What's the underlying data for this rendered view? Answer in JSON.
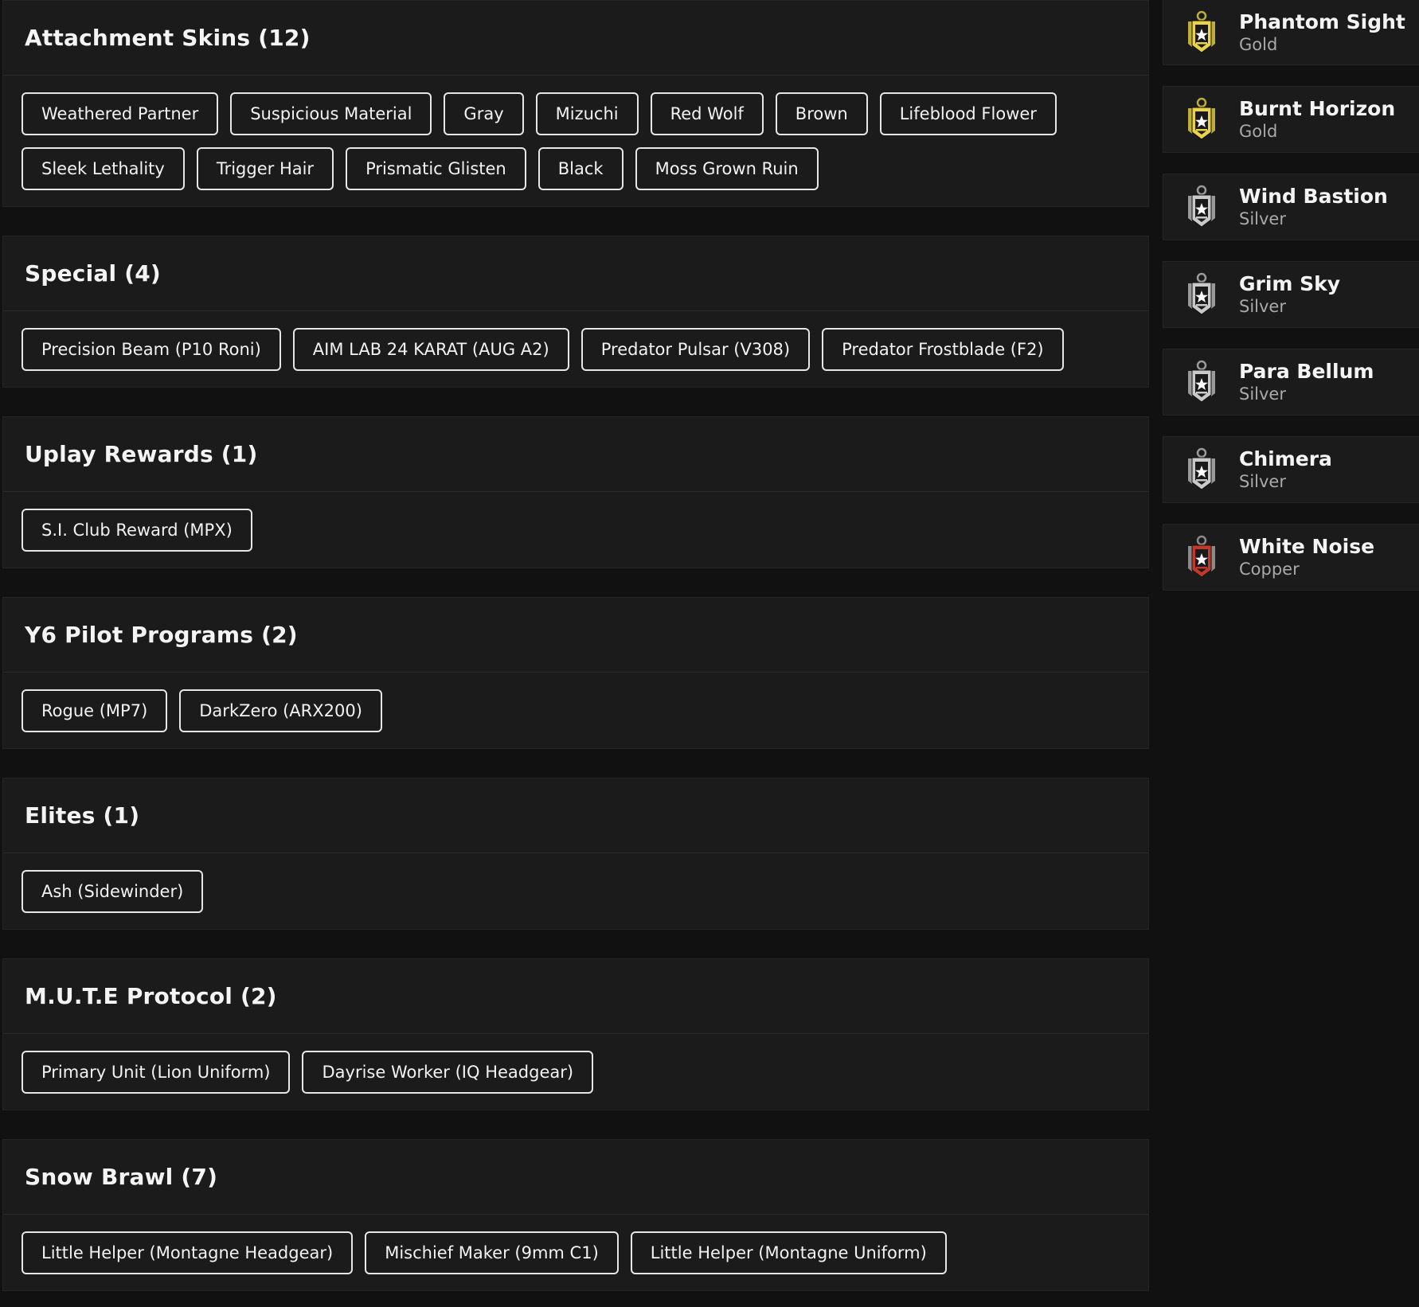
{
  "colors": {
    "gold": "#e8d34a",
    "silver": "#c9c9c9",
    "copper": "#c0392b",
    "background": "#111111",
    "panel": "#1b1b1c"
  },
  "sections": [
    {
      "title": "Attachment Skins (12)",
      "items": [
        "Weathered Partner",
        "Suspicious Material",
        "Gray",
        "Mizuchi",
        "Red Wolf",
        "Brown",
        "Lifeblood Flower",
        "Sleek Lethality",
        "Trigger Hair",
        "Prismatic Glisten",
        "Black",
        "Moss Grown Ruin"
      ]
    },
    {
      "title": "Special (4)",
      "items": [
        "Precision Beam (P10 Roni)",
        "AIM LAB 24 KARAT (AUG A2)",
        "Predator Pulsar (V308)",
        "Predator Frostblade (F2)"
      ]
    },
    {
      "title": "Uplay Rewards (1)",
      "items": [
        "S.I. Club Reward (MPX)"
      ]
    },
    {
      "title": "Y6 Pilot Programs (2)",
      "items": [
        "Rogue (MP7)",
        "DarkZero (ARX200)"
      ]
    },
    {
      "title": "Elites (1)",
      "items": [
        "Ash (Sidewinder)"
      ]
    },
    {
      "title": "M.U.T.E Protocol (2)",
      "items": [
        "Primary Unit (Lion Uniform)",
        "Dayrise Worker (IQ Headgear)"
      ]
    },
    {
      "title": "Snow Brawl (7)",
      "items": [
        "Little Helper (Montagne Headgear)",
        "Mischief Maker (9mm C1)",
        "Little Helper (Montagne Uniform)"
      ]
    }
  ],
  "operations": [
    {
      "name": "Phantom Sight",
      "rank": "Gold",
      "icon": "gold-rank-badge-icon"
    },
    {
      "name": "Burnt Horizon",
      "rank": "Gold",
      "icon": "gold-rank-badge-icon"
    },
    {
      "name": "Wind Bastion",
      "rank": "Silver",
      "icon": "silver-rank-badge-icon"
    },
    {
      "name": "Grim Sky",
      "rank": "Silver",
      "icon": "silver-rank-badge-icon"
    },
    {
      "name": "Para Bellum",
      "rank": "Silver",
      "icon": "silver-rank-badge-icon"
    },
    {
      "name": "Chimera",
      "rank": "Silver",
      "icon": "silver-rank-badge-icon"
    },
    {
      "name": "White Noise",
      "rank": "Copper",
      "icon": "copper-rank-badge-icon"
    }
  ]
}
